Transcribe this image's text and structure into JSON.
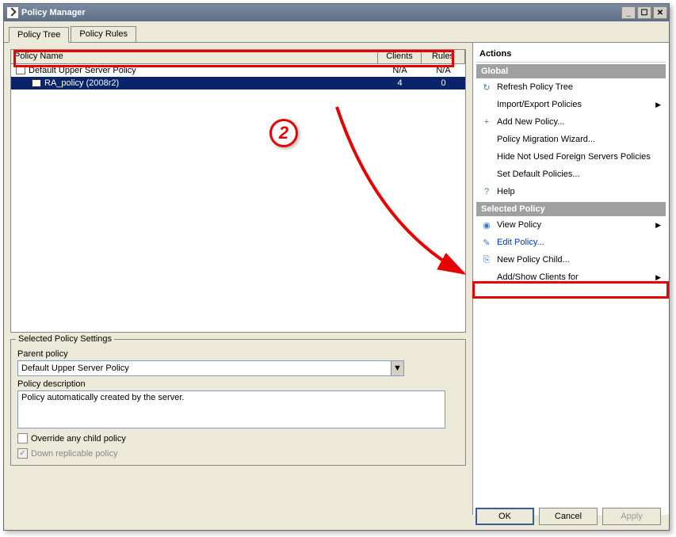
{
  "window": {
    "title": "Policy Manager"
  },
  "tabs": {
    "tree": "Policy Tree",
    "rules": "Policy Rules"
  },
  "grid": {
    "headers": {
      "name": "Policy Name",
      "clients": "Clients",
      "rules": "Rules"
    },
    "rows": [
      {
        "name": "Default Upper Server Policy",
        "clients": "N/A",
        "rules": "N/A"
      },
      {
        "name": "RA_policy (2008r2)",
        "clients": "4",
        "rules": "0"
      }
    ]
  },
  "settings": {
    "legend": "Selected Policy Settings",
    "parent_label": "Parent policy",
    "parent_value": "Default Upper Server Policy",
    "desc_label": "Policy description",
    "desc_value": "Policy automatically created by the server.",
    "override": "Override any child policy",
    "downrep": "Down replicable policy"
  },
  "actions": {
    "title": "Actions",
    "global": "Global",
    "refresh": "Refresh Policy Tree",
    "importexport": "Import/Export Policies",
    "addnew": "Add New Policy...",
    "migration": "Policy Migration Wizard...",
    "hideforeign": "Hide Not Used Foreign Servers Policies",
    "setdefault": "Set Default Policies...",
    "help": "Help",
    "selected": "Selected Policy",
    "view": "View Policy",
    "edit": "Edit Policy...",
    "newchild": "New Policy Child...",
    "addshow": "Add/Show Clients for"
  },
  "buttons": {
    "ok": "OK",
    "cancel": "Cancel",
    "apply": "Apply"
  },
  "annotation": {
    "num": "2"
  }
}
